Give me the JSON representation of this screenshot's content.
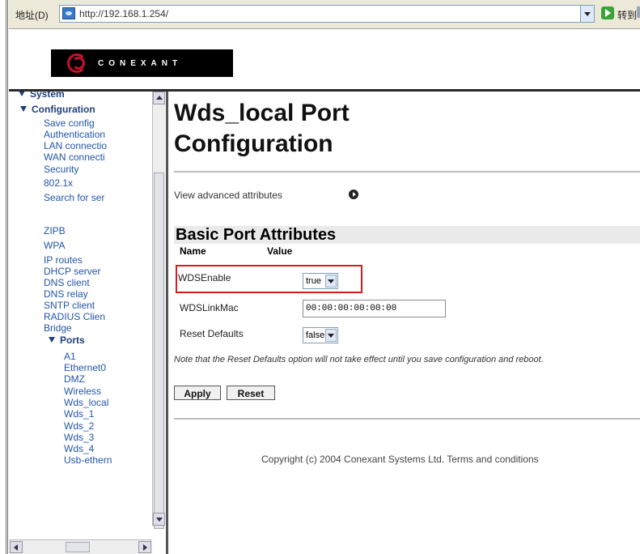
{
  "address_bar": {
    "label": "地址(D)",
    "url": "http://192.168.1.254/",
    "go_label": "转到"
  },
  "logo": {
    "text": "CONEXANT"
  },
  "sidebar": {
    "items": [
      {
        "label": "System",
        "type": "head-collapsed"
      },
      {
        "label": "Configuration",
        "type": "head"
      },
      {
        "label": "Save config"
      },
      {
        "label": "Authentication"
      },
      {
        "label": "LAN connectio"
      },
      {
        "label": "WAN connecti"
      },
      {
        "label": "Security"
      },
      {
        "label": "802.1x"
      },
      {
        "label": "Search for ser"
      },
      {
        "label": "ZIPB"
      },
      {
        "label": "WPA"
      },
      {
        "label": "IP routes"
      },
      {
        "label": "DHCP server"
      },
      {
        "label": "DNS client"
      },
      {
        "label": "DNS relay"
      },
      {
        "label": "SNTP client"
      },
      {
        "label": "RADIUS Clien"
      },
      {
        "label": "Bridge"
      },
      {
        "label": "Ports",
        "type": "subhead"
      },
      {
        "label": "A1"
      },
      {
        "label": "Ethernet0"
      },
      {
        "label": "DMZ"
      },
      {
        "label": "Wireless"
      },
      {
        "label": "Wds_local"
      },
      {
        "label": "Wds_1"
      },
      {
        "label": "Wds_2"
      },
      {
        "label": "Wds_3"
      },
      {
        "label": "Wds_4"
      },
      {
        "label": "Usb-ethern"
      }
    ]
  },
  "main": {
    "title_line1": "Wds_local Port",
    "title_line2": "Configuration",
    "advanced_link": "View advanced attributes",
    "section_title": "Basic Port Attributes",
    "col_name": "Name",
    "col_value": "Value",
    "rows": {
      "wds_enable": {
        "label": "WDSEnable",
        "value": "true"
      },
      "wds_link_mac": {
        "label": "WDSLinkMac",
        "value": "00:00:00:00:00:00"
      },
      "reset_defaults": {
        "label": "Reset Defaults",
        "value": "false"
      }
    },
    "note": "Note that the Reset Defaults option will not take effect until you save configuration and reboot.",
    "apply_label": "Apply",
    "reset_label": "Reset",
    "copyright": "Copyright (c) 2004 Conexant Systems Ltd. Terms and conditions"
  },
  "colors": {
    "highlight": "#d21d1d",
    "link": "#2255aa",
    "logo_accent": "#c8102e"
  }
}
